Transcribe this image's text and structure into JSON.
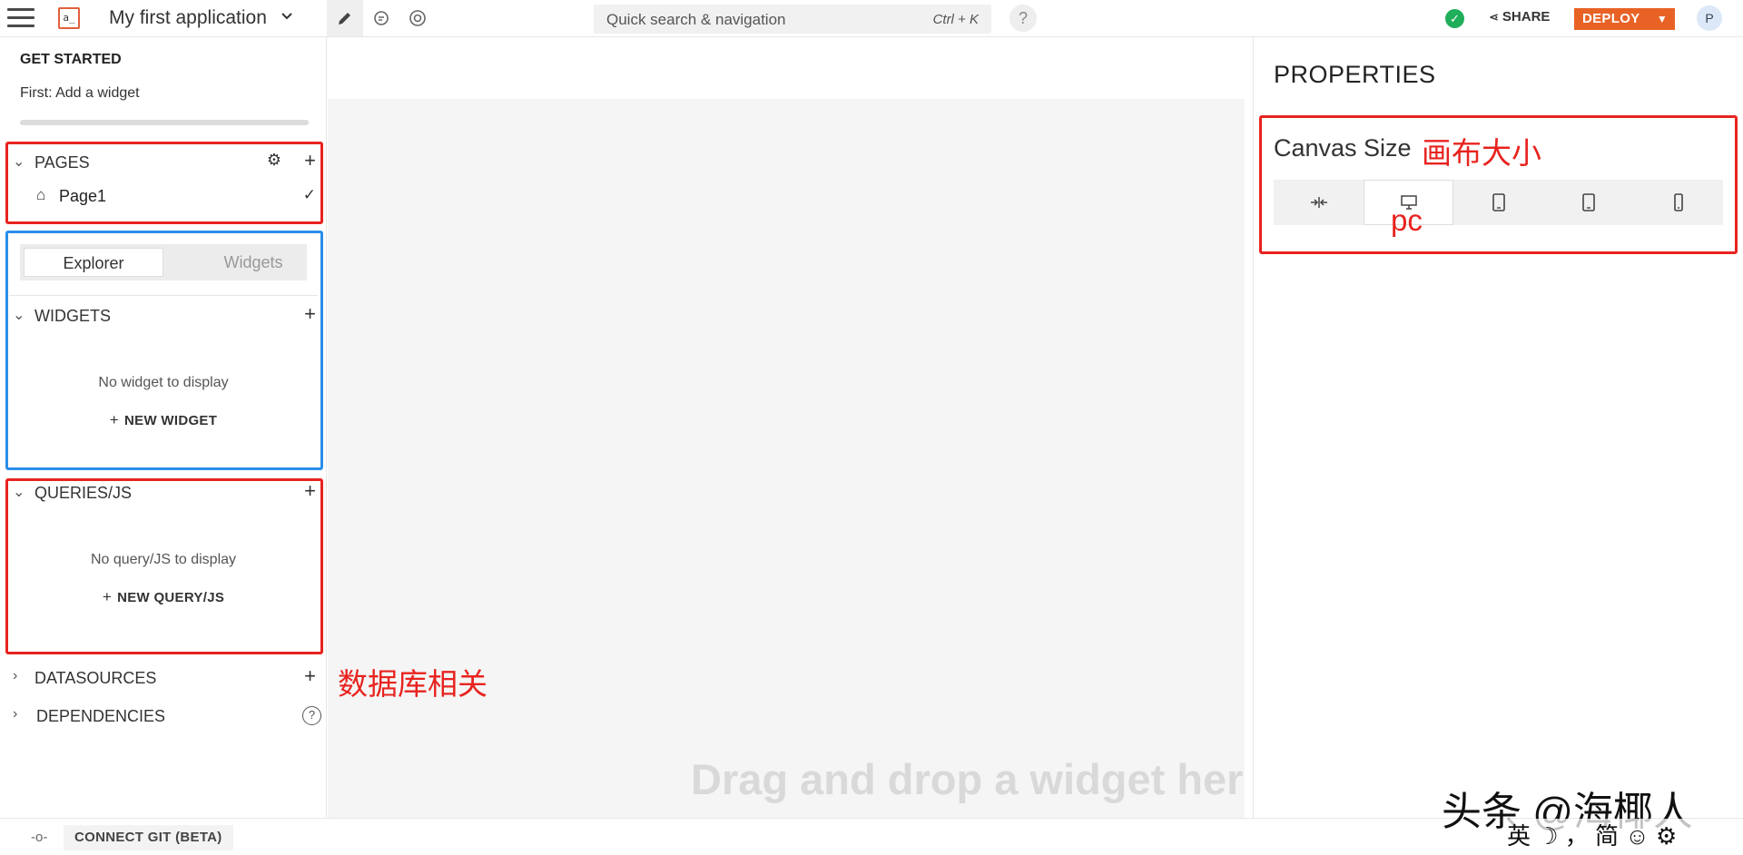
{
  "topbar": {
    "app_title": "My first application",
    "search_placeholder": "Quick search & navigation",
    "search_shortcut": "Ctrl + K",
    "help": "?",
    "share_label": "SHARE",
    "deploy_label": "DEPLOY",
    "avatar_initial": "P"
  },
  "sidebar": {
    "get_started_title": "GET STARTED",
    "get_started_step": "First: Add a widget",
    "pages_label": "PAGES",
    "page_name": "Page1",
    "tabs": [
      "Explorer",
      "Widgets"
    ],
    "widgets_label": "WIDGETS",
    "widgets_empty": "No widget to display",
    "new_widget_label": "NEW WIDGET",
    "queries_label": "QUERIES/JS",
    "queries_empty": "No query/JS to display",
    "new_query_label": "NEW QUERY/JS",
    "datasources_label": "DATASOURCES",
    "dependencies_label": "DEPENDENCIES"
  },
  "canvas": {
    "drop_hint": "Drag and drop a widget here"
  },
  "properties": {
    "title": "PROPERTIES",
    "canvas_size_label": "Canvas Size",
    "size_options": [
      "fluid-width-icon",
      "desktop-icon",
      "tablet-landscape-icon",
      "tablet-portrait-icon",
      "mobile-icon"
    ],
    "selected_size_index": 1
  },
  "annotations": {
    "canvas_size_note": "画布大小",
    "pc_note": "pc",
    "datasources_note": "数据库相关"
  },
  "bottombar": {
    "connect_git_label": "CONNECT GIT (BETA)"
  },
  "overlay": {
    "watermark": "头条 @海椰人",
    "ime_bar": "英 ☽ ， 简 ☺ ⚙"
  },
  "colors": {
    "deploy": "#e86226",
    "annotation_red": "#e8231f",
    "annotation_blue": "#2a8ee8",
    "status_ok": "#1fae5a"
  }
}
